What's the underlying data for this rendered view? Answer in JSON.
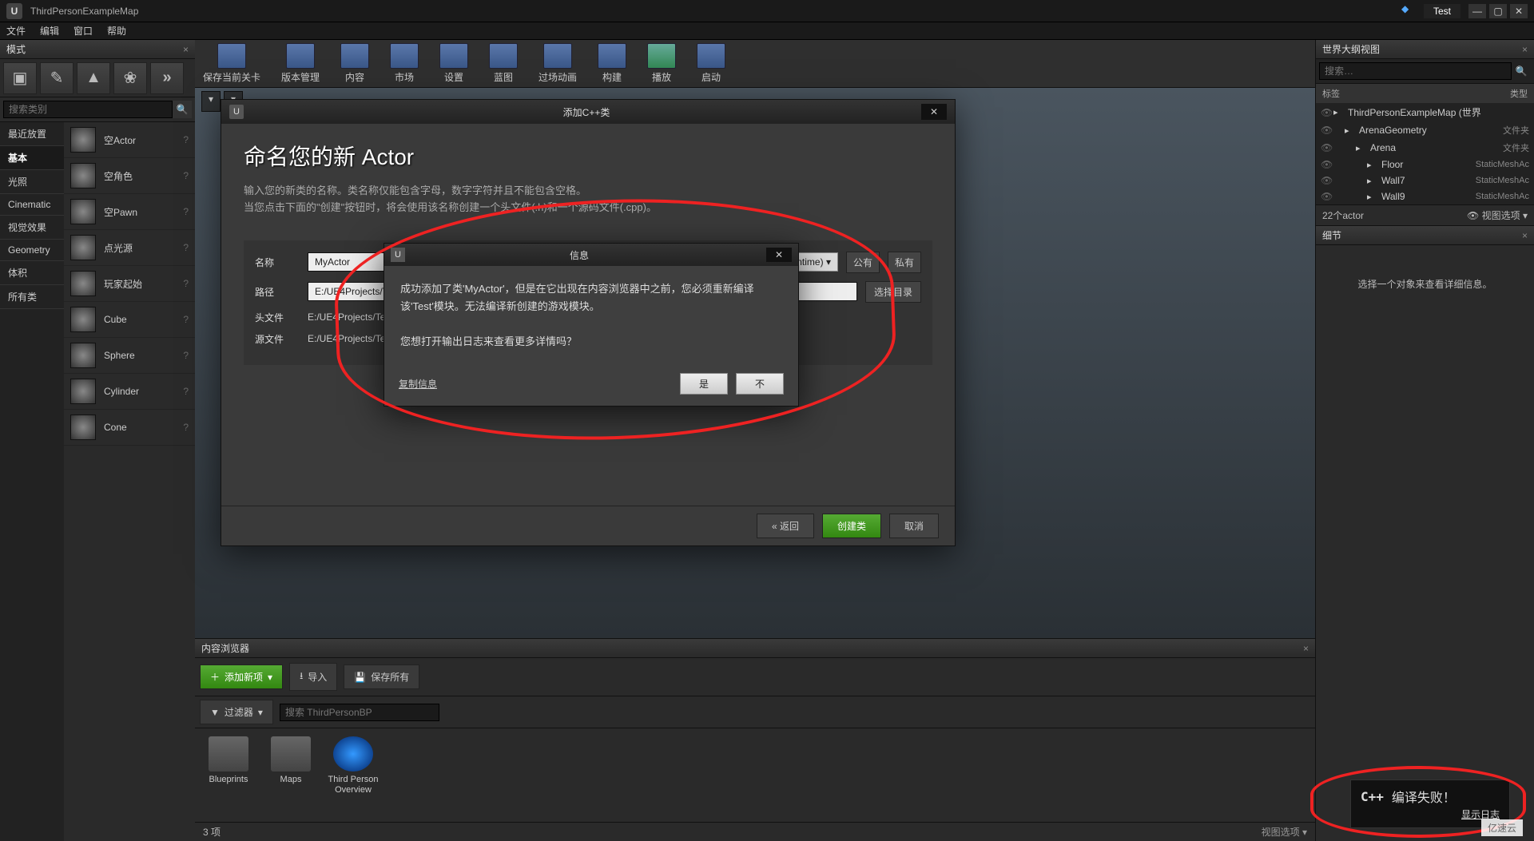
{
  "titlebar": {
    "logo": "U",
    "title": "ThirdPersonExampleMap",
    "project": "Test"
  },
  "menu": {
    "file": "文件",
    "edit": "编辑",
    "window": "窗口",
    "help": "帮助"
  },
  "modes_panel": {
    "title": "模式",
    "search_placeholder": "搜索类别",
    "categories": {
      "recent": "最近放置",
      "basic": "基本",
      "lighting": "光照",
      "cinematic": "Cinematic",
      "vfx": "视觉效果",
      "geometry": "Geometry",
      "volumes": "体积",
      "all": "所有类"
    },
    "items": [
      {
        "label": "空Actor"
      },
      {
        "label": "空角色"
      },
      {
        "label": "空Pawn"
      },
      {
        "label": "点光源"
      },
      {
        "label": "玩家起始"
      },
      {
        "label": "Cube"
      },
      {
        "label": "Sphere"
      },
      {
        "label": "Cylinder"
      },
      {
        "label": "Cone"
      }
    ]
  },
  "toolbar": {
    "save": "保存当前关卡",
    "version": "版本管理",
    "content": "内容",
    "market": "市场",
    "settings": "设置",
    "blueprint": "蓝图",
    "cinematic": "过场动画",
    "build": "构建",
    "play": "播放",
    "launch": "启动"
  },
  "wizard": {
    "window_title": "添加C++类",
    "heading": "命名您的新 Actor",
    "desc_line1": "输入您的新类的名称。类名称仅能包含字母，数字字符并且不能包含空格。",
    "desc_line2": "当您点击下面的\"创建\"按钮时，将会使用该名称创建一个头文件(.h)和一个源码文件(.cpp)。",
    "name_label": "名称",
    "name_value": "MyActor",
    "module_value": "Test (Runtime)",
    "public": "公有",
    "private": "私有",
    "path_label": "路径",
    "path_value": "E:/UE4Projects/Test",
    "choose_dir": "选择目录",
    "header_label": "头文件",
    "header_value": "E:/UE4Projects/Test/",
    "source_label": "源文件",
    "source_value": "E:/UE4Projects/Test/",
    "back": "返回",
    "create": "创建类",
    "cancel": "取消"
  },
  "msgbox": {
    "title": "信息",
    "body_line1": "成功添加了类'MyActor'，但是在它出现在内容浏览器中之前，您必须重新编译该'Test'模块。无法编译新创建的游戏模块。",
    "body_line2": "您想打开输出日志来查看更多详情吗？",
    "copy": "复制信息",
    "yes": "是",
    "no": "不"
  },
  "content_browser": {
    "title": "内容浏览器",
    "add": "添加新项",
    "import": "导入",
    "saveall": "保存所有",
    "filters": "过滤器",
    "search_placeholder": "搜索 ThirdPersonBP",
    "items": [
      {
        "label": "Blueprints"
      },
      {
        "label": "Maps"
      },
      {
        "label": "Third Person Overview"
      }
    ],
    "count": "3 项",
    "viewopt": "视图选项"
  },
  "outliner": {
    "title": "世界大纲视图",
    "search_placeholder": "搜索…",
    "col_label": "标签",
    "col_type": "类型",
    "rows": [
      {
        "indent": 0,
        "name": "ThirdPersonExampleMap (世界",
        "type": ""
      },
      {
        "indent": 1,
        "name": "ArenaGeometry",
        "type": "文件夹"
      },
      {
        "indent": 2,
        "name": "Arena",
        "type": "文件夹"
      },
      {
        "indent": 3,
        "name": "Floor",
        "type": "StaticMeshAc"
      },
      {
        "indent": 3,
        "name": "Wall7",
        "type": "StaticMeshAc"
      },
      {
        "indent": 3,
        "name": "Wall9",
        "type": "StaticMeshAc"
      }
    ],
    "count": "22个actor",
    "viewopt": "视图选项"
  },
  "details": {
    "title": "细节",
    "msg": "选择一个对象来查看详细信息。"
  },
  "compile_fail": {
    "cpp": "C++",
    "text": "编译失败！",
    "link": "显示日志"
  },
  "watermark": "亿速云"
}
